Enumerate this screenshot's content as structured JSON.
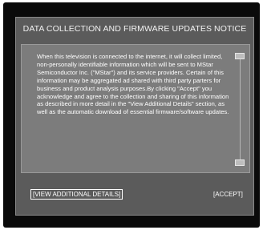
{
  "dialog": {
    "title": "DATA COLLECTION AND FIRMWARE UPDATES NOTICE",
    "body": "When this television is connected to the internet, it will collect limited, non-personally identifiable information which will be sent to MStar Semiconductor Inc. (\"MStar\") and its service providers. Certain of this information may be aggregated ad shared with third party parters for business and product analysis purposes.By clicking \"Accept\" you acknowledge and agree to the collection and sharing of this information as described in more detail in the \"View Additional Details\" section, as well as the automatic download of essential firmware/software updates.",
    "details_button": "[VIEW ADDITIONAL DETAILS]",
    "accept_button": "[ACCEPT]"
  },
  "colors": {
    "screen": "#0a0a0a",
    "dialog_bg": "#5b5b5b",
    "panel_bg": "#7c7c7c",
    "text": "#ffffff"
  }
}
